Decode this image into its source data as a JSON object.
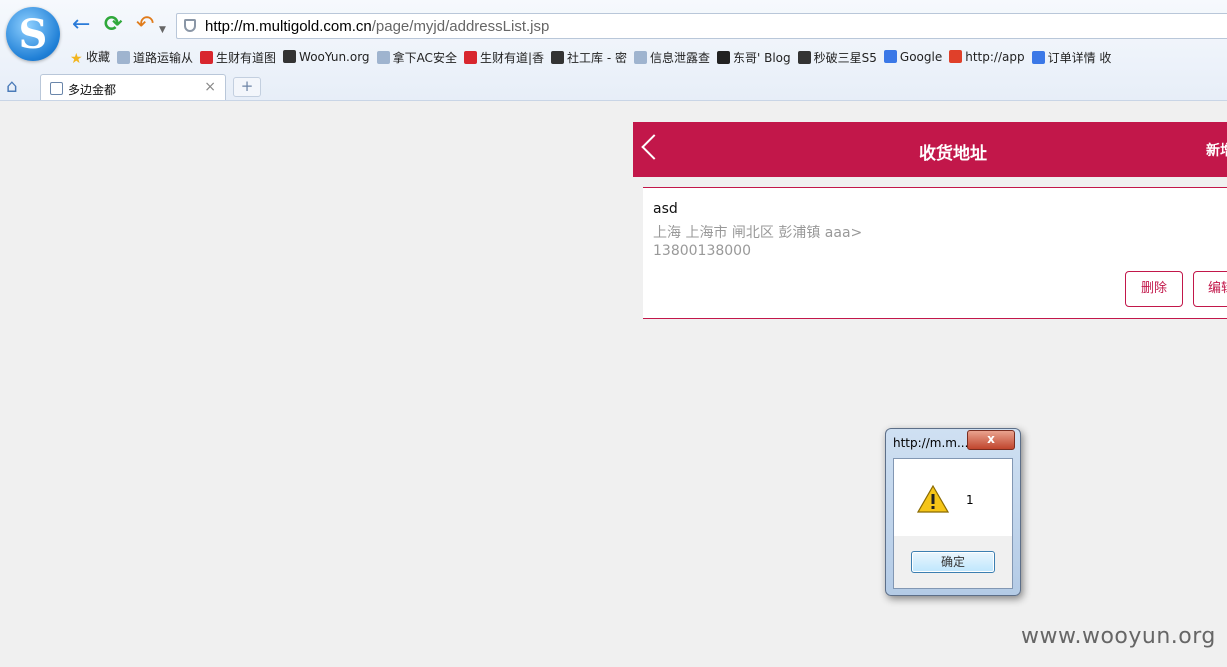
{
  "browser": {
    "url_domain": "http://m.multigold.com.cn",
    "url_path": "/page/myjd/addressList.jsp",
    "bookmarks": [
      {
        "label": "收藏",
        "color": "#f2b51e"
      },
      {
        "label": "道路运输从",
        "color": "#9fb4cf"
      },
      {
        "label": "生财有道图",
        "color": "#d8262e"
      },
      {
        "label": "WooYun.org",
        "color": "#333333"
      },
      {
        "label": "拿下AC安全",
        "color": "#9fb4cf"
      },
      {
        "label": "生财有道|香",
        "color": "#d8262e"
      },
      {
        "label": "社工库 - 密",
        "color": "#333333"
      },
      {
        "label": "信息泄露查",
        "color": "#9fb4cf"
      },
      {
        "label": "东哥' Blog",
        "color": "#222222"
      },
      {
        "label": "秒破三星S5",
        "color": "#333333"
      },
      {
        "label": "Google",
        "color": "#3b78e7"
      },
      {
        "label": "http://app",
        "color": "#e0402a"
      },
      {
        "label": "订单详情 收",
        "color": "#3b78e7"
      }
    ],
    "tab_title": "多边金都",
    "tab_close": "×",
    "new_tab": "+"
  },
  "page": {
    "title": "收货地址",
    "add_label": "新增"
  },
  "address": {
    "name": "asd",
    "address": "上海 上海市 闸北区 彭浦镇 aaa>",
    "phone": "13800138000",
    "delete_label": "删除",
    "edit_label": "编辑"
  },
  "dialog": {
    "title": "http://m.m...",
    "close": "x",
    "message": "1",
    "ok_label": "确定"
  },
  "watermark": "www.wooyun.org"
}
